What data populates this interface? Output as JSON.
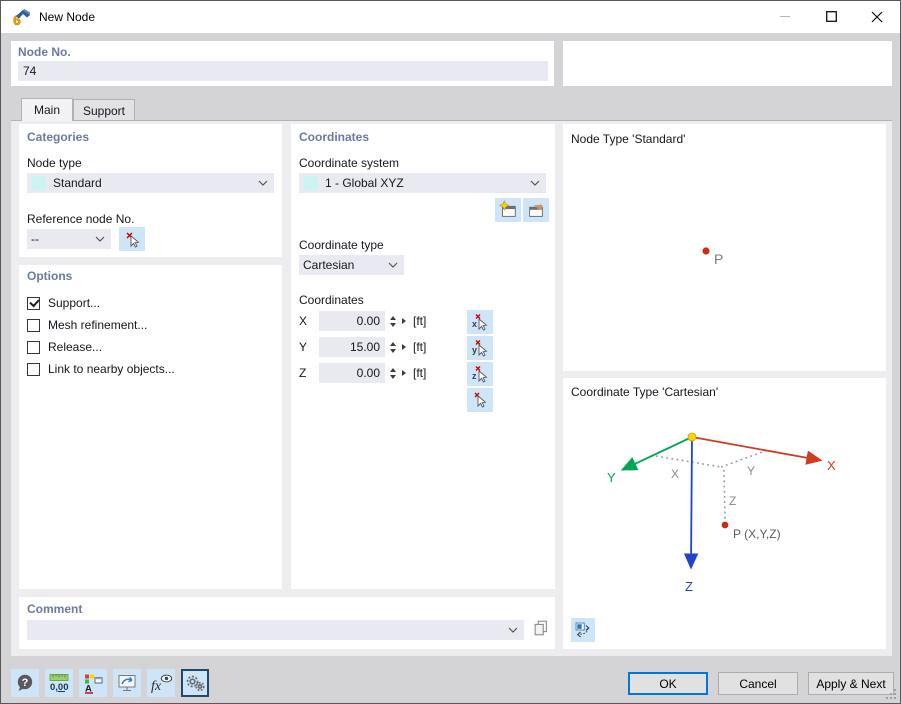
{
  "window": {
    "title": "New Node"
  },
  "header": {
    "node_no_label": "Node No.",
    "node_no_value": "74"
  },
  "tabs": [
    {
      "label": "Main",
      "active": true
    },
    {
      "label": "Support",
      "active": false
    }
  ],
  "categories": {
    "title": "Categories",
    "node_type_label": "Node type",
    "node_type_value": "Standard",
    "reference_node_label": "Reference node No.",
    "reference_node_value": "--"
  },
  "options": {
    "title": "Options",
    "items": [
      {
        "label": "Support...",
        "checked": true
      },
      {
        "label": "Mesh refinement...",
        "checked": false
      },
      {
        "label": "Release...",
        "checked": false
      },
      {
        "label": "Link to nearby objects...",
        "checked": false
      }
    ]
  },
  "coordinates": {
    "title": "Coordinates",
    "system_label": "Coordinate system",
    "system_value": "1 - Global XYZ",
    "type_label": "Coordinate type",
    "type_value": "Cartesian",
    "values_label": "Coordinates",
    "rows": [
      {
        "axis": "X",
        "pick_letter": "x",
        "value": "0.00",
        "unit": "[ft]"
      },
      {
        "axis": "Y",
        "pick_letter": "y",
        "value": "15.00",
        "unit": "[ft]"
      },
      {
        "axis": "Z",
        "pick_letter": "z",
        "value": "0.00",
        "unit": "[ft]"
      }
    ]
  },
  "preview": {
    "node_type_title": "Node Type 'Standard'",
    "point_label": "P",
    "coordinate_type_title": "Coordinate Type 'Cartesian'",
    "axis_x_label": "X",
    "axis_y_label": "Y",
    "axis_z_label": "Z",
    "proj_x_label": "X",
    "proj_y_label": "Y",
    "proj_z_label": "Z",
    "point_full_label": "P (X,Y,Z)"
  },
  "comment": {
    "title": "Comment",
    "value": ""
  },
  "toolbar": {
    "units_text": "0,00",
    "fx_text": "fx",
    "active_index": 5
  },
  "footer": {
    "ok_label": "OK",
    "cancel_label": "Cancel",
    "apply_next_label": "Apply & Next"
  },
  "colors": {
    "accent": "#0078d7",
    "axis_x": "#d23b1e",
    "axis_y": "#00a651",
    "axis_z": "#2244cc",
    "origin_point": "#ffd400",
    "node_point": "#c8300d",
    "header_text": "#6b7a9f",
    "field_bg": "#e9e9f1",
    "pick_button_bg": "#cde5f7"
  }
}
